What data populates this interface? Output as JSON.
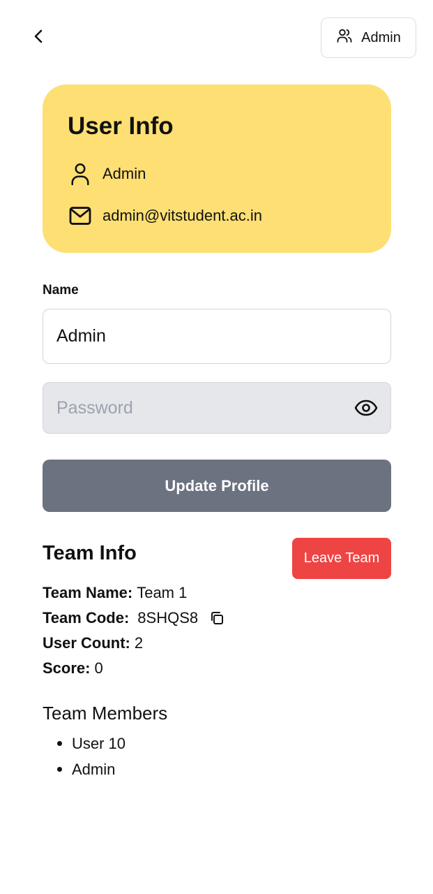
{
  "header": {
    "admin_button_label": "Admin"
  },
  "user_card": {
    "title": "User Info",
    "name": "Admin",
    "email": "admin@vitstudent.ac.in",
    "background_color": "#fddf74"
  },
  "form": {
    "name_label": "Name",
    "name_value": "Admin",
    "password_placeholder": "Password",
    "update_button_label": "Update Profile",
    "update_button_color": "#6b7280"
  },
  "team": {
    "title": "Team Info",
    "leave_button_label": "Leave Team",
    "leave_button_color": "#ef4444",
    "team_name_label": "Team Name:",
    "team_name_value": "Team 1",
    "team_code_label": "Team Code:",
    "team_code_value": "8SHQS8",
    "user_count_label": "User Count:",
    "user_count_value": "2",
    "score_label": "Score:",
    "score_value": "0",
    "members_title": "Team Members",
    "members": [
      "User 10",
      "Admin"
    ]
  },
  "icons": {
    "back": "chevron-left-icon",
    "admin": "users-icon",
    "user": "user-icon",
    "email": "mail-icon",
    "eye": "eye-icon",
    "copy": "copy-icon"
  }
}
